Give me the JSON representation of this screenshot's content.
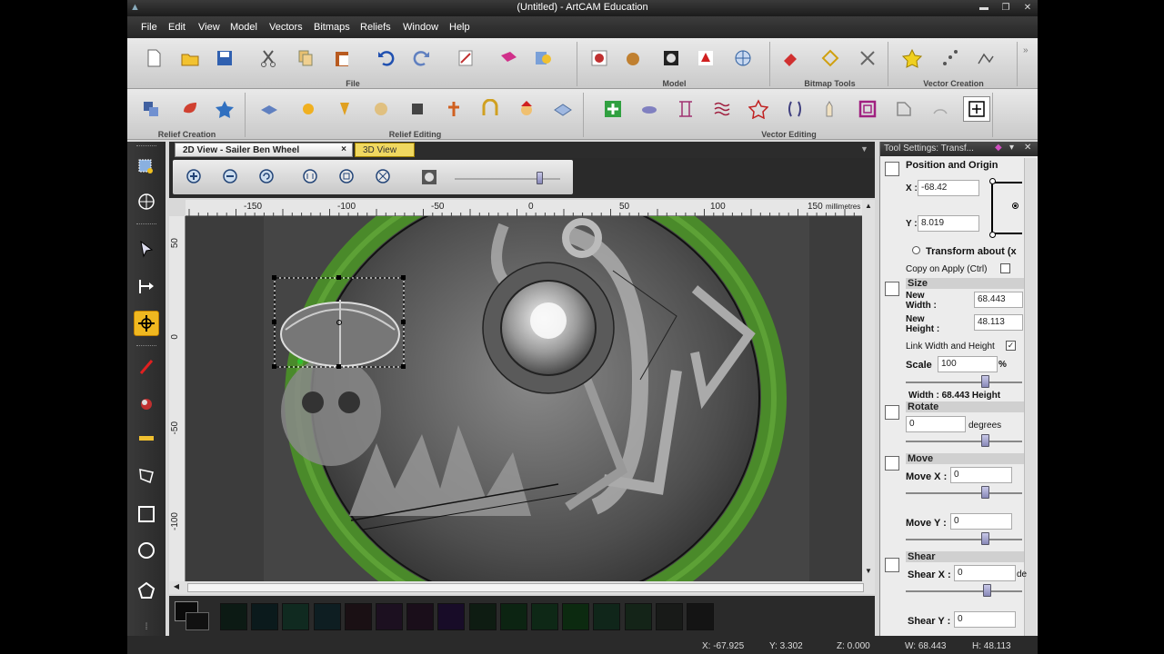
{
  "window": {
    "title": "(Untitled) - ArtCAM Education"
  },
  "menu": [
    "File",
    "Edit",
    "View",
    "Model",
    "Vectors",
    "Bitmaps",
    "Reliefs",
    "Window",
    "Help"
  ],
  "toolbar_groups": {
    "file": "File",
    "model": "Model",
    "bitmap_tools": "Bitmap Tools",
    "vector_creation": "Vector Creation",
    "relief_creation": "Relief Creation",
    "relief_editing": "Relief Editing",
    "vector_editing": "Vector Editing"
  },
  "tabs": {
    "view2d": "2D View - Sailer Ben Wheel",
    "view2d_close": "×",
    "view3d": "3D View"
  },
  "ruler": {
    "h_ticks": [
      "-150",
      "-100",
      "-50",
      "0",
      "50",
      "100",
      "150"
    ],
    "h_unit": "millimetres",
    "v_ticks": [
      "50",
      "0",
      "-50",
      "-100"
    ]
  },
  "panel": {
    "title": "Tool Settings: Transf...",
    "position_origin": "Position and Origin",
    "x_label": "X :",
    "x_value": "-68.42",
    "y_label": "Y :",
    "y_value": "8.019",
    "transform_about": "Transform about (x",
    "copy_on_apply": "Copy on Apply (Ctrl)",
    "copy_checked": false,
    "size": "Size",
    "new_width_label": "New Width :",
    "new_width": "68.443",
    "new_height_label": "New Height :",
    "new_height": "48.113",
    "link_wh": "Link Width and Height",
    "link_checked": true,
    "scale_label": "Scale",
    "scale_value": "100",
    "scale_unit": "%",
    "width_readout": "Width :  68.443  Height",
    "rotate": "Rotate",
    "rotate_value": "0",
    "rotate_unit": "degrees",
    "move": "Move",
    "move_x_label": "Move X :",
    "move_x": "0",
    "move_y_label": "Move Y :",
    "move_y": "0",
    "shear": "Shear",
    "shear_x_label": "Shear X :",
    "shear_x": "0",
    "shear_x_unit": "de",
    "shear_y_label": "Shear Y :",
    "shear_y": "0"
  },
  "status": {
    "x": "X: -67.925",
    "y": "Y: 3.302",
    "z": "Z: 0.000",
    "w": "W: 68.443",
    "h": "H: 48.113"
  },
  "colors": {
    "accent": "#f0c000",
    "ring": "#4a8a2a",
    "titlebar": "#1c1c1c"
  }
}
